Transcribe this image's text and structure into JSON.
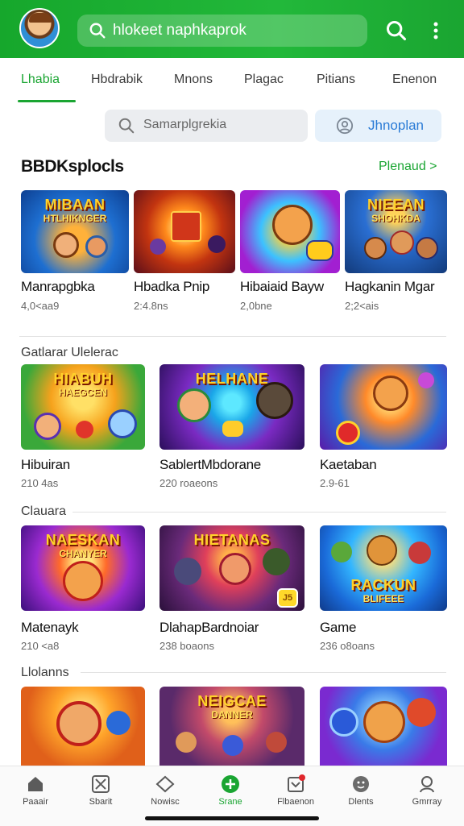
{
  "colors": {
    "brand": "#1aa532",
    "accent_blue": "#2a7bd6",
    "badge": "#e0262b"
  },
  "header": {
    "search_text": "hlokeet naphkaprok",
    "icons": [
      "search-icon",
      "more-vert-icon",
      "avatar"
    ]
  },
  "tabs": [
    {
      "label": "Lhabia",
      "active": true
    },
    {
      "label": "Hbdrabik",
      "active": false
    },
    {
      "label": "Mnons",
      "active": false
    },
    {
      "label": "Plagac",
      "active": false
    },
    {
      "label": "Pitians",
      "active": false
    },
    {
      "label": "Enenon",
      "active": false
    }
  ],
  "subsearch": {
    "placeholder": "Samarplgrekia",
    "profile_label": "Jhnoplan"
  },
  "section": {
    "title": "BBDKsplocls",
    "more": "Plenaud >"
  },
  "row1": [
    {
      "art_title": "MIBAAN",
      "art_sub": "HTLHIKNGER",
      "name": "Manrapgbka",
      "meta": "4,0<aa9"
    },
    {
      "art_title": "",
      "art_sub": "",
      "name": "Hbadka Pnip",
      "meta": "2:4.8ns"
    },
    {
      "art_title": "",
      "art_sub": "",
      "name": "Hibaiaid Bayw",
      "meta": "2,0bne"
    },
    {
      "art_title": "NIEEAN",
      "art_sub": "SHOHKDA",
      "name": "Hagkanin Mgar",
      "meta": "2;2<ais"
    }
  ],
  "group2": {
    "label": "Gatlarar Ulelerac"
  },
  "row2": [
    {
      "art_title": "HIABUH",
      "art_sub": "HAEGCEN",
      "name": "Hibuiran",
      "meta": "210 4as"
    },
    {
      "art_title": "HELHANE",
      "art_sub": "",
      "name": "SablertMbdorane",
      "meta": "220 roaeons"
    },
    {
      "art_title": "",
      "art_sub": "",
      "name": "Kaetaban",
      "meta": "2.9-61"
    }
  ],
  "group3": {
    "label": "Clauara"
  },
  "row3": [
    {
      "art_title": "NAESKAN",
      "art_sub": "CHANYER",
      "name": "Matenayk",
      "meta": "210 <a8"
    },
    {
      "art_title": "HIETANAS",
      "art_sub": "",
      "name": "DlahapBardnoiar",
      "meta": "238 boaons",
      "badge": "J5"
    },
    {
      "art_title": "RACKUN",
      "art_sub": "BLIFEEE",
      "name": "Game",
      "meta": "236 o8oans"
    }
  ],
  "group4": {
    "label": "Llolanns"
  },
  "row4": [
    {
      "art_title": "",
      "art_sub": ""
    },
    {
      "art_title": "NEIGCAE",
      "art_sub": "DANNER"
    },
    {
      "art_title": "",
      "art_sub": ""
    }
  ],
  "bottom_nav": [
    {
      "label": "Paaair",
      "icon": "home-icon",
      "active": false
    },
    {
      "label": "Sbarit",
      "icon": "grid-icon",
      "active": false
    },
    {
      "label": "Nowisc",
      "icon": "diamond-icon",
      "active": false
    },
    {
      "label": "Srane",
      "icon": "plus-circle-icon",
      "active": true
    },
    {
      "label": "Flbaenon",
      "icon": "inbox-icon",
      "active": false,
      "badge": true
    },
    {
      "label": "Dlents",
      "icon": "smile-icon",
      "active": false
    },
    {
      "label": "Gmrray",
      "icon": "person-icon",
      "active": false
    }
  ]
}
